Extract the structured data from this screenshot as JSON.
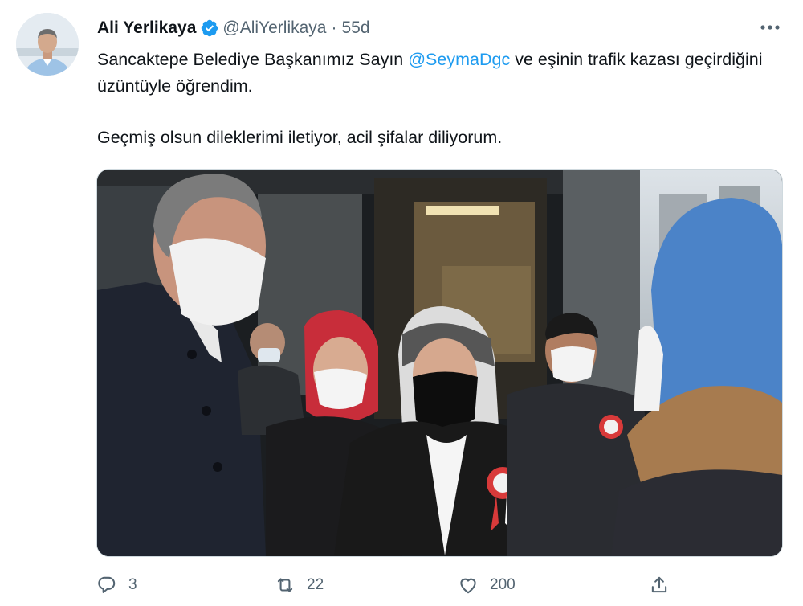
{
  "author": {
    "name": "Ali Yerlikaya",
    "handle": "@AliYerlikaya",
    "separator": "·",
    "time": "55d",
    "verified": true
  },
  "tweet": {
    "line1_before": "Sancaktepe Belediye Başkanımız Sayın ",
    "mention": "@SeymaDgc",
    "line1_after": " ve eşinin trafik kazası geçirdiğini üzüntüyle öğrendim.",
    "paragraph2": "Geçmiş olsun dileklerimi iletiyor, acil şifalar diliyorum."
  },
  "actions": {
    "reply": {
      "icon": "reply-icon",
      "count": "3"
    },
    "retweet": {
      "icon": "retweet-icon",
      "count": "22"
    },
    "like": {
      "icon": "heart-icon",
      "count": "200"
    },
    "share": {
      "icon": "share-icon"
    }
  },
  "colors": {
    "link": "#1d9bf0",
    "muted": "#536471",
    "verified": "#1d9bf0",
    "text": "#0f1419"
  }
}
